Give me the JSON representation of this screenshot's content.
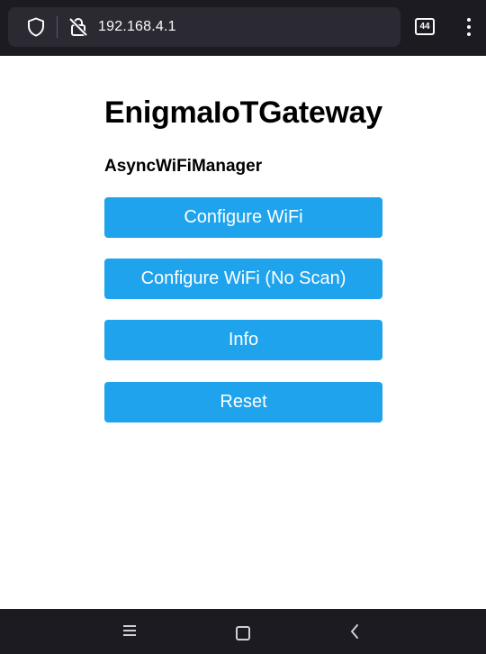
{
  "browser": {
    "url": "192.168.4.1",
    "tab_count": "44",
    "icons": {
      "shield": "shield-icon",
      "insecure_lock": "insecure-lock-icon",
      "tabs": "tabs-icon",
      "menu": "kebab-menu-icon"
    }
  },
  "page": {
    "title": "EnigmaIoTGateway",
    "subtitle": "AsyncWiFiManager",
    "buttons": [
      {
        "label": "Configure WiFi"
      },
      {
        "label": "Configure WiFi (No Scan)"
      },
      {
        "label": "Info"
      },
      {
        "label": "Reset"
      }
    ],
    "button_color": "#1fa3ec"
  },
  "system_nav": {
    "icons": [
      "recents-icon",
      "home-icon",
      "back-icon"
    ]
  }
}
